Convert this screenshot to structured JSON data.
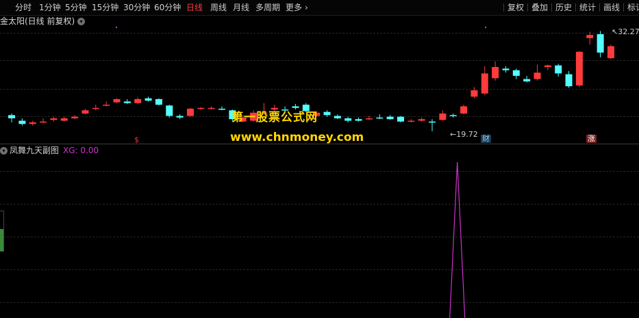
{
  "toolbar": {
    "periods": [
      {
        "label": "分时",
        "active": false
      },
      {
        "label": "1分钟",
        "active": false
      },
      {
        "label": "5分钟",
        "active": false
      },
      {
        "label": "15分钟",
        "active": false
      },
      {
        "label": "30分钟",
        "active": false
      },
      {
        "label": "60分钟",
        "active": false
      },
      {
        "label": "日线",
        "active": true
      },
      {
        "label": "周线",
        "active": false
      },
      {
        "label": "月线",
        "active": false
      },
      {
        "label": "多周期",
        "active": false
      },
      {
        "label": "更多",
        "active": false
      }
    ],
    "more_arrow": "›",
    "tools": [
      "复权",
      "叠加",
      "历史",
      "统计",
      "画线",
      "标记"
    ]
  },
  "main_panel": {
    "title": "金太阳(日线 前复权)",
    "high_label": "32.27",
    "low_label": "19.72",
    "markers": {
      "s": "$",
      "cai": "财",
      "zhang": "涨"
    }
  },
  "watermark": {
    "line1": "第一股票公式网",
    "line2": "www.chnmoney.com"
  },
  "sub_panel": {
    "title": "凤舞九天副图",
    "xg": "XG: 0.00"
  },
  "colors": {
    "up": "#ff3b3b",
    "down": "#54ffff",
    "xg_line": "#cc33cc",
    "watermark": "#ffd700"
  },
  "left_gauge_level": 0.55,
  "chart_data": {
    "type": "candlestick",
    "price_range": [
      19.0,
      33.5
    ],
    "candles": [
      [
        21.7,
        21.3,
        21.9,
        20.8
      ],
      [
        21.0,
        20.6,
        21.3,
        20.4
      ],
      [
        20.6,
        20.8,
        21.0,
        20.4
      ],
      [
        20.9,
        20.9,
        21.3,
        20.7
      ],
      [
        21.1,
        21.3,
        21.5,
        20.9
      ],
      [
        21.0,
        21.3,
        21.5,
        20.9
      ],
      [
        21.3,
        21.5,
        21.7,
        21.2
      ],
      [
        21.9,
        22.3,
        22.5,
        21.8
      ],
      [
        22.5,
        22.6,
        23.0,
        22.3
      ],
      [
        22.9,
        23.0,
        23.4,
        22.8
      ],
      [
        23.3,
        23.7,
        23.8,
        23.2
      ],
      [
        23.4,
        23.2,
        23.7,
        23.1
      ],
      [
        23.2,
        23.7,
        23.9,
        23.1
      ],
      [
        23.8,
        23.5,
        24.0,
        23.4
      ],
      [
        23.7,
        23.0,
        23.8,
        22.9
      ],
      [
        22.9,
        21.6,
        23.0,
        21.4
      ],
      [
        21.6,
        21.4,
        21.8,
        21.2
      ],
      [
        21.6,
        22.5,
        22.6,
        21.5
      ],
      [
        22.6,
        22.6,
        22.7,
        22.4
      ],
      [
        22.5,
        22.6,
        22.8,
        22.4
      ],
      [
        22.5,
        22.4,
        22.8,
        22.3
      ],
      [
        22.3,
        21.2,
        22.4,
        21.0
      ],
      [
        20.9,
        21.4,
        21.7,
        20.8
      ],
      [
        21.0,
        22.0,
        22.3,
        20.9
      ],
      [
        21.9,
        22.0,
        23.2,
        21.8
      ],
      [
        22.4,
        22.6,
        23.0,
        22.2
      ],
      [
        22.4,
        22.3,
        22.8,
        22.1
      ],
      [
        22.8,
        22.6,
        23.1,
        22.4
      ],
      [
        23.0,
        22.2,
        23.2,
        22.1
      ],
      [
        21.6,
        22.0,
        22.2,
        21.5
      ],
      [
        22.1,
        21.7,
        22.3,
        21.5
      ],
      [
        21.6,
        21.3,
        21.8,
        21.2
      ],
      [
        21.3,
        21.0,
        21.5,
        20.8
      ],
      [
        21.2,
        21.0,
        21.4,
        20.9
      ],
      [
        21.2,
        21.3,
        21.6,
        21.1
      ],
      [
        21.4,
        21.3,
        21.8,
        21.2
      ],
      [
        21.5,
        21.2,
        21.7,
        21.1
      ],
      [
        21.5,
        20.9,
        21.6,
        20.8
      ],
      [
        20.9,
        21.0,
        21.2,
        20.8
      ],
      [
        21.0,
        21.2,
        21.4,
        20.9
      ],
      [
        20.9,
        20.8,
        21.2,
        19.7
      ],
      [
        21.1,
        21.9,
        22.3,
        21.0
      ],
      [
        21.7,
        21.6,
        21.9,
        21.4
      ],
      [
        21.9,
        22.8,
        23.0,
        21.8
      ],
      [
        24.0,
        24.8,
        25.2,
        23.8
      ],
      [
        24.4,
        26.9,
        27.8,
        24.2
      ],
      [
        26.3,
        27.7,
        28.4,
        26.0
      ],
      [
        27.5,
        27.3,
        27.8,
        27.0
      ],
      [
        27.3,
        26.6,
        27.5,
        26.2
      ],
      [
        26.2,
        25.9,
        26.6,
        25.8
      ],
      [
        26.2,
        27.0,
        28.0,
        26.0
      ],
      [
        27.7,
        27.9,
        28.0,
        27.3
      ],
      [
        27.9,
        26.9,
        28.1,
        26.5
      ],
      [
        26.8,
        25.3,
        27.2,
        25.1
      ],
      [
        25.4,
        29.6,
        29.7,
        25.2
      ],
      [
        31.3,
        31.7,
        32.1,
        30.5
      ],
      [
        31.8,
        29.5,
        32.2,
        28.9
      ],
      [
        28.8,
        30.3,
        30.5,
        28.7
      ]
    ],
    "xg_signal": {
      "peak_index": 42,
      "peak_value_fraction": 0.95
    }
  }
}
